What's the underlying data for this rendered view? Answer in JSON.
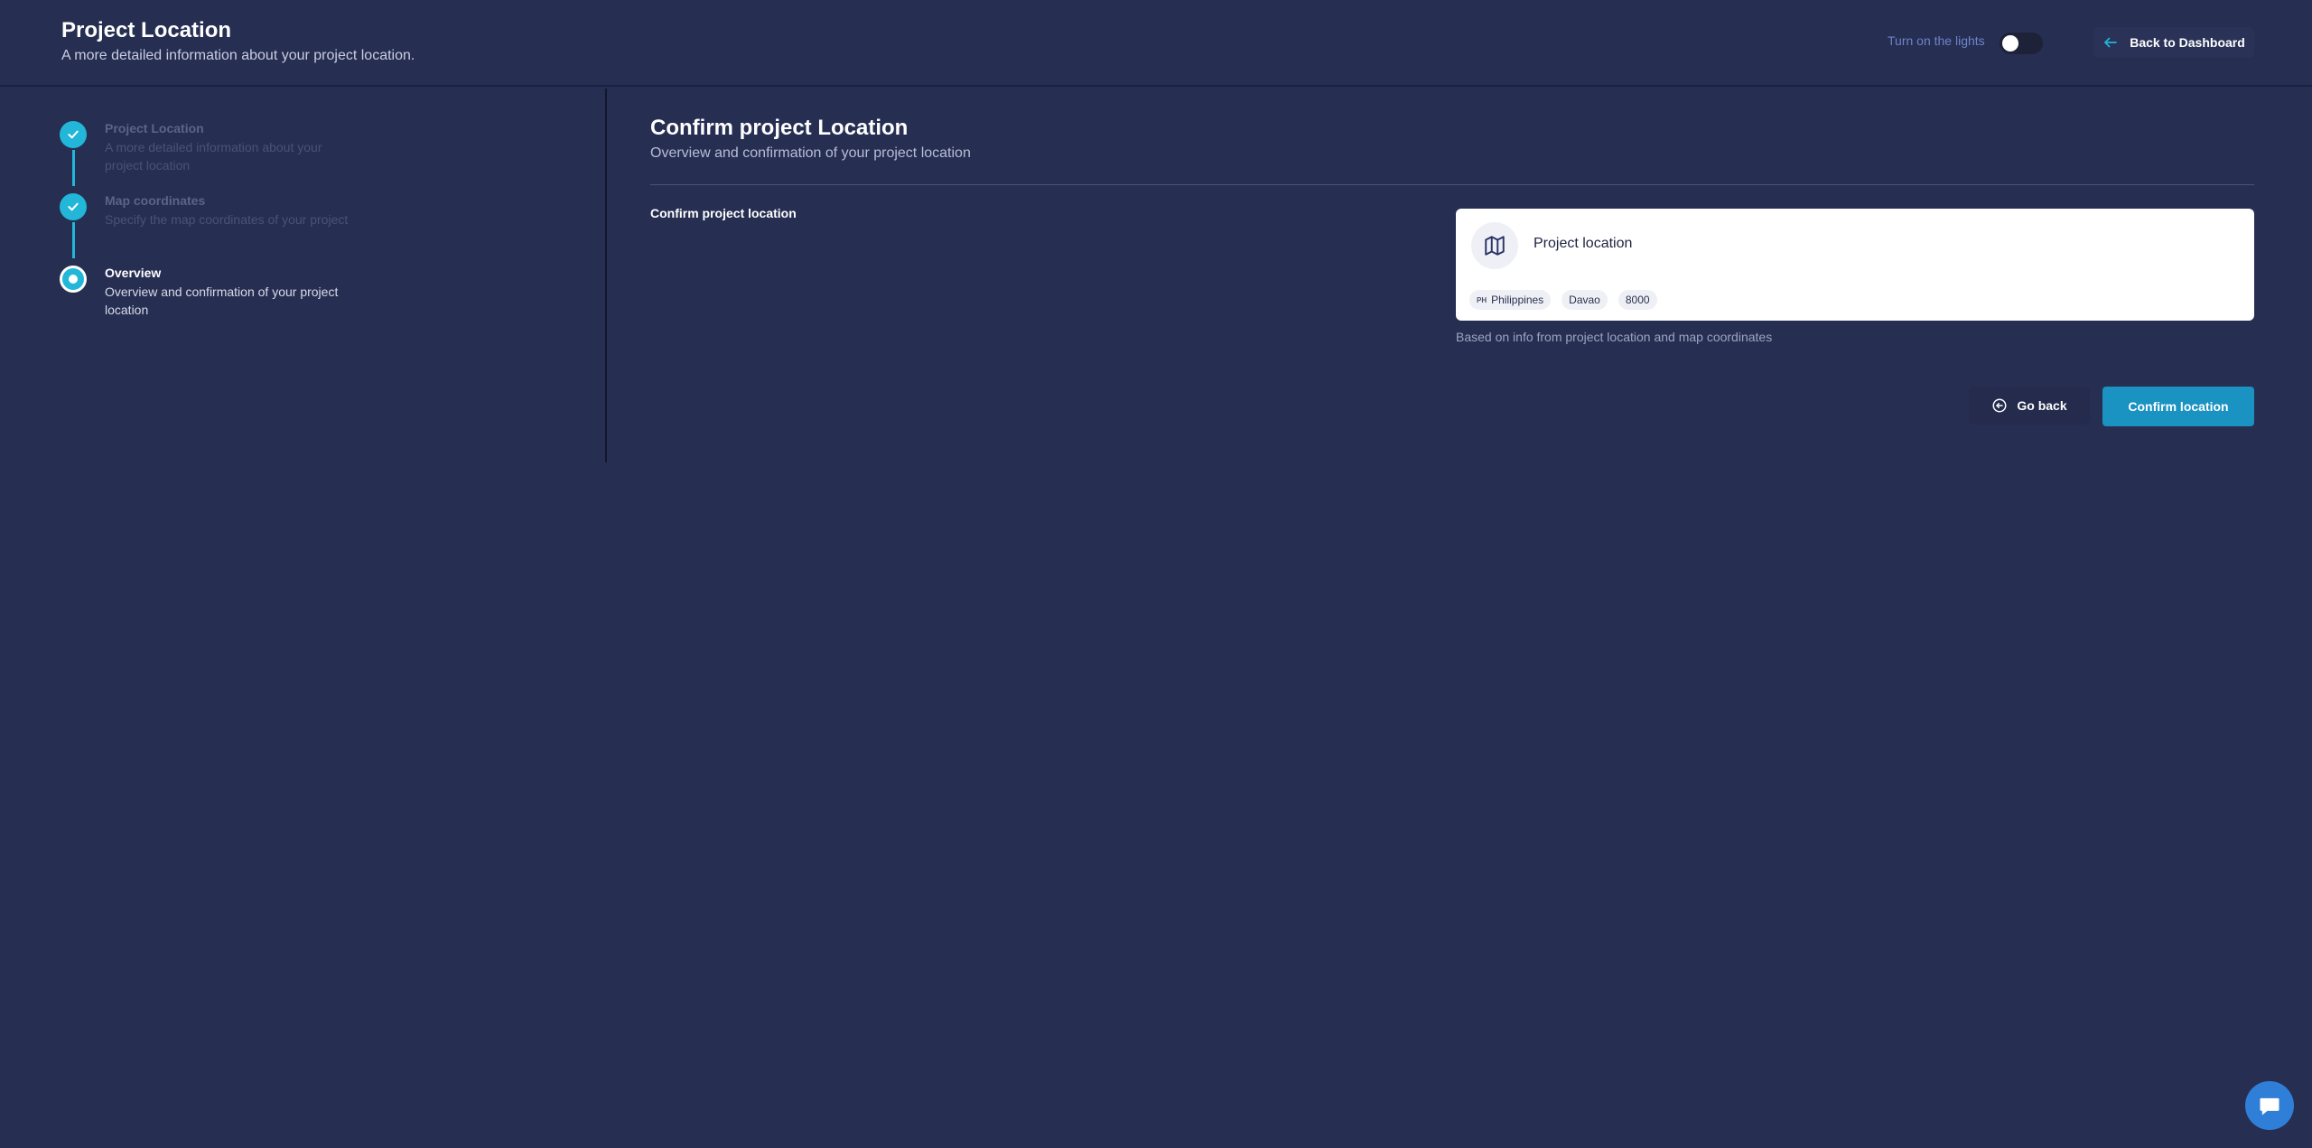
{
  "header": {
    "title": "Project Location",
    "subtitle": "A more detailed information about your project location.",
    "lights_label": "Turn on the lights",
    "back_label": "Back to Dashboard"
  },
  "steps": [
    {
      "title": "Project Location",
      "description": "A more detailed information about your project location",
      "status": "done"
    },
    {
      "title": "Map coordinates",
      "description": "Specify the map coordinates of your project",
      "status": "done"
    },
    {
      "title": "Overview",
      "description": "Overview and confirmation of your project location",
      "status": "current"
    }
  ],
  "main": {
    "title": "Confirm project Location",
    "subtitle": "Overview and confirmation of your project location",
    "section_label": "Confirm project location",
    "card": {
      "title": "Project location",
      "chips": [
        {
          "code": "PH",
          "label": "Philippines"
        },
        {
          "code": "",
          "label": "Davao"
        },
        {
          "code": "",
          "label": "8000"
        }
      ],
      "note": "Based on info from project location and map coordinates"
    },
    "go_back_label": "Go back",
    "confirm_label": "Confirm location"
  },
  "colors": {
    "background": "#262e52",
    "accent": "#22b6d8",
    "primary_button": "#1a92c2",
    "chat_button": "#2f7fd9"
  },
  "icons": [
    "arrow-left-icon",
    "check-icon",
    "map-icon",
    "arrow-circle-left-icon",
    "chat-icon"
  ]
}
